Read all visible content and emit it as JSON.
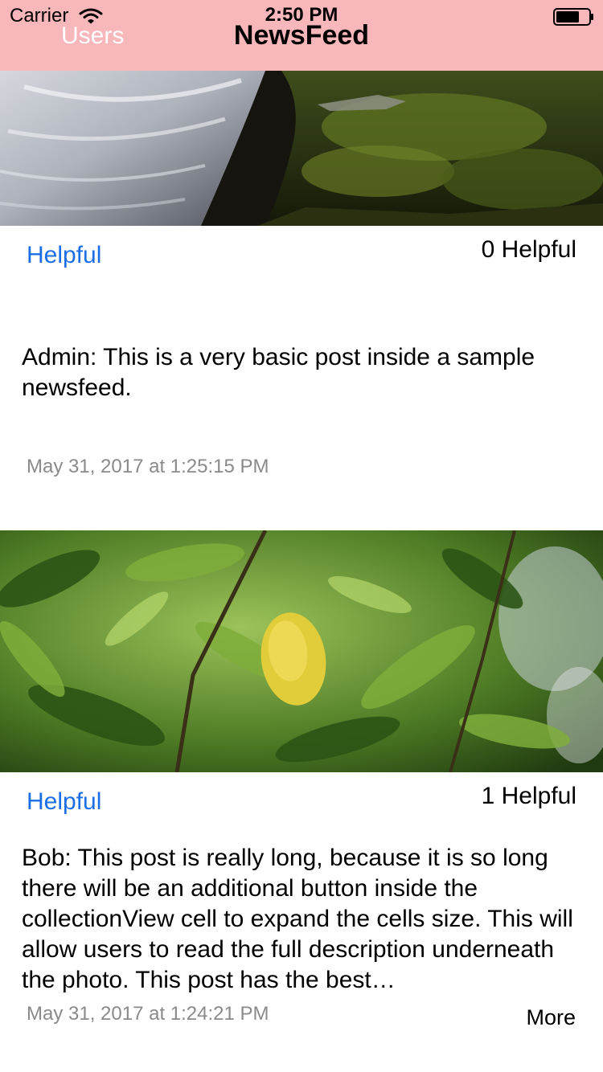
{
  "status_bar": {
    "carrier": "Carrier",
    "time": "2:50 PM"
  },
  "nav": {
    "back_label": "Users",
    "title": "NewsFeed",
    "bar_color": "#f7b7bb"
  },
  "posts": [
    {
      "image_icon": "waterfall-moss-photo",
      "helpful_label": "Helpful",
      "helpful_count": "0 Helpful",
      "text": "Admin: This is a very basic post inside a sample newsfeed.",
      "date": "May 31, 2017 at 1:25:15 PM"
    },
    {
      "image_icon": "green-leaves-photo",
      "helpful_label": "Helpful",
      "helpful_count": "1 Helpful",
      "text": "Bob: This post is really long, because it is so long there will be an additional button inside the collectionView cell to expand the cells size. This will allow users to read the full description underneath the photo. This post has the best…",
      "date": "May 31, 2017 at 1:24:21 PM",
      "more_label": "More"
    }
  ],
  "colors": {
    "link_blue": "#1b6fe6",
    "date_gray": "#8a8a8a"
  }
}
